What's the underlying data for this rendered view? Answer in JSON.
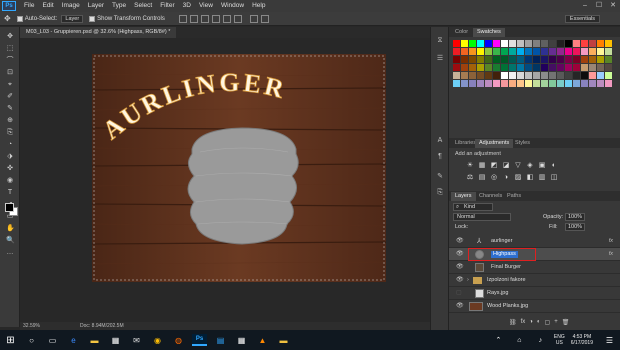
{
  "menubar": {
    "logo": "Ps",
    "items": [
      "File",
      "Edit",
      "Image",
      "Layer",
      "Type",
      "Select",
      "Filter",
      "3D",
      "View",
      "Window",
      "Help"
    ],
    "controls": [
      "–",
      "☐",
      "✕"
    ]
  },
  "options": {
    "auto_select": "Auto-Select:",
    "auto_select_value": "Layer",
    "show_transform": "Show Transform Controls",
    "workspace": "Essentials"
  },
  "document": {
    "tab_title": "M03_L03 - Gruppieren.psd @ 32.6% (Highpass, RGB/8#) *",
    "canvas_text": "AURLINGER",
    "zoom": "32.59%",
    "doc_info": "Doc: 8.94M/202.5M"
  },
  "color_panel": {
    "tabs": [
      "Color",
      "Swatches"
    ],
    "active_tab": "Swatches",
    "swatch_colors": [
      "#ff0000",
      "#ffff00",
      "#00ff00",
      "#00ffff",
      "#0000ff",
      "#ff00ff",
      "#ffffff",
      "#e0e0e0",
      "#c0c0c0",
      "#a0a0a0",
      "#808080",
      "#606060",
      "#404040",
      "#202020",
      "#000000",
      "#ff8080",
      "#ff4040",
      "#c04040",
      "#ff8000",
      "#ffc000",
      "#ed1c24",
      "#f26522",
      "#f7941d",
      "#fff200",
      "#8dc63f",
      "#39b54a",
      "#00a651",
      "#00a99d",
      "#00aeef",
      "#0072bc",
      "#0054a6",
      "#2e3192",
      "#662d91",
      "#92278f",
      "#ec008c",
      "#ed145b",
      "#f49ac1",
      "#fbaf5d",
      "#fff799",
      "#c4df9b",
      "#790000",
      "#7b2e00",
      "#7d4900",
      "#827b00",
      "#406618",
      "#005e20",
      "#005826",
      "#005952",
      "#005b7f",
      "#003471",
      "#002157",
      "#1b1464",
      "#32004b",
      "#4b0049",
      "#7b0046",
      "#7a0026",
      "#a0410d",
      "#a36209",
      "#aba000",
      "#598527",
      "#9e0b0f",
      "#a0410d",
      "#a36209",
      "#aba000",
      "#598527",
      "#1a7b30",
      "#007236",
      "#00746b",
      "#0076a3",
      "#004b80",
      "#003663",
      "#21005d",
      "#440e62",
      "#630460",
      "#9e005d",
      "#9e0039",
      "#c69c6d",
      "#998675",
      "#736357",
      "#534741",
      "#c7b299",
      "#a67c52",
      "#8c6239",
      "#754c24",
      "#603913",
      "#42210b",
      "#ffffff",
      "#f2f2f2",
      "#d9d9d9",
      "#bfbfbf",
      "#a6a6a6",
      "#8c8c8c",
      "#737373",
      "#595959",
      "#404040",
      "#262626",
      "#0d0d0d",
      "#ff9999",
      "#99ccff",
      "#ccff99",
      "#6dcff6",
      "#8393ca",
      "#8781bd",
      "#a186be",
      "#bd8cbf",
      "#f49ac2",
      "#f6989d",
      "#f9ad81",
      "#fdc68a",
      "#fff79a",
      "#c4df9b",
      "#a3d39c",
      "#82ca9c",
      "#7accc8",
      "#6ecff6",
      "#7da7d9",
      "#8882be",
      "#a187be",
      "#bc8dbf",
      "#f29ac1"
    ]
  },
  "adjustments_panel": {
    "tabs": [
      "Libraries",
      "Adjustments",
      "Styles"
    ],
    "active_tab": "Adjustments",
    "heading": "Add an adjustment",
    "icons": [
      "☀",
      "▦",
      "◩",
      "◪",
      "▽",
      "◈",
      "▣",
      "◐",
      "⚖",
      "▤",
      "◎",
      "◑",
      "▨",
      "◧",
      "▥",
      "◫"
    ]
  },
  "layers_panel": {
    "tabs": [
      "Layers",
      "Channels",
      "Paths"
    ],
    "active_tab": "Layers",
    "filter_label": "Kind",
    "blend_mode": "Normal",
    "opacity_label": "Opacity:",
    "opacity_value": "100%",
    "lock_label": "Lock:",
    "fill_label": "Fill:",
    "fill_value": "100%",
    "layers": [
      {
        "name": "aurlinger",
        "type": "text",
        "visible": true,
        "fx": "fx"
      },
      {
        "name": "Highpass",
        "type": "smart",
        "visible": true,
        "selected": true,
        "fx": "fx"
      },
      {
        "name": "Final Burger",
        "type": "image",
        "visible": true,
        "fx": ""
      },
      {
        "name": "Izpolzoni fakore",
        "type": "group",
        "visible": true,
        "fx": ""
      },
      {
        "name": "Rays.jpg",
        "type": "image",
        "visible": false,
        "fx": ""
      },
      {
        "name": "Wood Planks.jpg",
        "type": "image",
        "visible": true,
        "fx": ""
      }
    ],
    "footer_icons": [
      "⛓",
      "fx",
      "◑",
      "◐",
      "▢",
      "+",
      "🗑"
    ]
  },
  "tools": [
    "✥",
    "⬚",
    "⌒",
    "⊡",
    "⌖",
    "✐",
    "✎",
    "⊕",
    "⎘",
    "◔",
    "⬗",
    "✜",
    "◉",
    "T",
    "➚",
    "▭",
    "✋",
    "🔍",
    "…"
  ],
  "taskbar": {
    "lang": "ENG",
    "lang2": "US",
    "time": "4:53 PM",
    "date": "6/17/2019"
  }
}
